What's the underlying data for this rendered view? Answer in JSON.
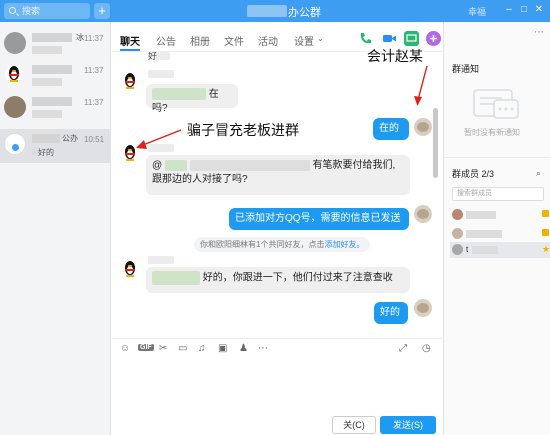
{
  "titlebar": {
    "search_placeholder": "搜索",
    "add_label": "+",
    "title": "办公群",
    "user": "幸福",
    "minimize": "–",
    "maximize": "□",
    "close": "✕"
  },
  "contacts": [
    {
      "time": "11:37",
      "snippet": "冰"
    },
    {
      "time": "11:37",
      "snippet": ""
    },
    {
      "time": "11:37",
      "snippet": ""
    },
    {
      "time": "10:51",
      "snippet": "好的",
      "name_tail": "公办"
    }
  ],
  "tabs": [
    "聊天",
    "公告",
    "相册",
    "文件",
    "活动",
    "设置"
  ],
  "chat": {
    "top_cut": "好",
    "msg1": "在吗?",
    "msg2_mention": "@",
    "msg2_tail": "有笔款要付给我们,",
    "msg2_line2": "跟那边的人对接了吗?",
    "reply1": "在的",
    "reply2": "已添加对方QQ号，需要的信息已发送",
    "system_note": "你和欧阳细林有1个共同好友，点击",
    "system_link": "添加好友。",
    "msg3": "好的，你跟进一下，他们付过来了注意查收",
    "reply3": "好的"
  },
  "annotations": {
    "accountant": "会计赵某",
    "scammer": "骗子冒充老板进群"
  },
  "input": {
    "close_label": "关(C)",
    "send_label": "发送(S)"
  },
  "right_panel": {
    "notice_title": "群通知",
    "notice_empty": "暂时没有新通知",
    "members_title": "群成员 2/3",
    "member_search_placeholder": "搜索群成员",
    "member3_prefix": "t"
  },
  "colors": {
    "accent": "#1e9bf0",
    "titlebar": "#3d9df0",
    "arrow": "#e0201c"
  }
}
